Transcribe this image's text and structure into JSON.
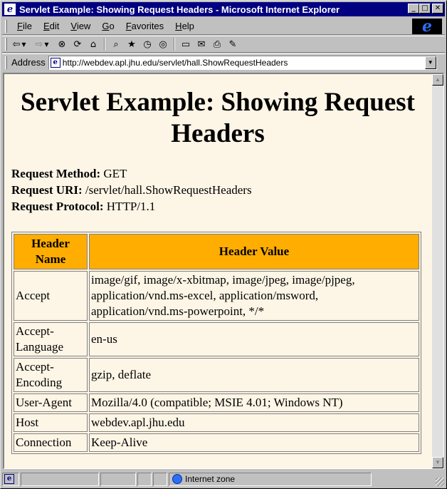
{
  "window": {
    "title": "Servlet Example: Showing Request Headers - Microsoft Internet Explorer"
  },
  "menu": {
    "items": [
      {
        "label": "File",
        "accel": "F",
        "rest": "ile"
      },
      {
        "label": "Edit",
        "accel": "E",
        "rest": "dit"
      },
      {
        "label": "View",
        "accel": "V",
        "rest": "iew"
      },
      {
        "label": "Go",
        "accel": "G",
        "rest": "o"
      },
      {
        "label": "Favorites",
        "accel": "F",
        "rest": "avorites"
      },
      {
        "label": "Help",
        "accel": "H",
        "rest": "elp"
      }
    ]
  },
  "address": {
    "label": "Address",
    "url": "http://webdev.apl.jhu.edu/servlet/hall.ShowRequestHeaders"
  },
  "page": {
    "heading": "Servlet Example: Showing Request Headers",
    "request_method_label": "Request Method:",
    "request_method": "GET",
    "request_uri_label": "Request URI:",
    "request_uri": "/servlet/hall.ShowRequestHeaders",
    "request_protocol_label": "Request Protocol:",
    "request_protocol": "HTTP/1.1",
    "table": {
      "headers": [
        "Header Name",
        "Header Value"
      ],
      "rows": [
        [
          "Accept",
          "image/gif, image/x-xbitmap, image/jpeg, image/pjpeg, application/vnd.ms-excel, application/msword, application/vnd.ms-powerpoint, */*"
        ],
        [
          "Accept-Language",
          "en-us"
        ],
        [
          "Accept-Encoding",
          "gzip, deflate"
        ],
        [
          "User-Agent",
          "Mozilla/4.0 (compatible; MSIE 4.01; Windows NT)"
        ],
        [
          "Host",
          "webdev.apl.jhu.edu"
        ],
        [
          "Connection",
          "Keep-Alive"
        ]
      ]
    }
  },
  "status": {
    "zone": "Internet zone"
  },
  "icons": {
    "back": "back-arrow-icon",
    "forward": "forward-arrow-icon",
    "stop": "stop-icon",
    "refresh": "refresh-icon",
    "home": "home-icon",
    "search": "search-icon",
    "favorites": "favorites-icon",
    "history": "history-icon",
    "channels": "channels-icon",
    "fullscreen": "fullscreen-icon",
    "mail": "mail-icon",
    "print": "print-icon",
    "edit": "edit-icon"
  },
  "colors": {
    "titlebar": "#000080",
    "page_background": "#fdf5e6",
    "table_header": "#ffad00"
  }
}
